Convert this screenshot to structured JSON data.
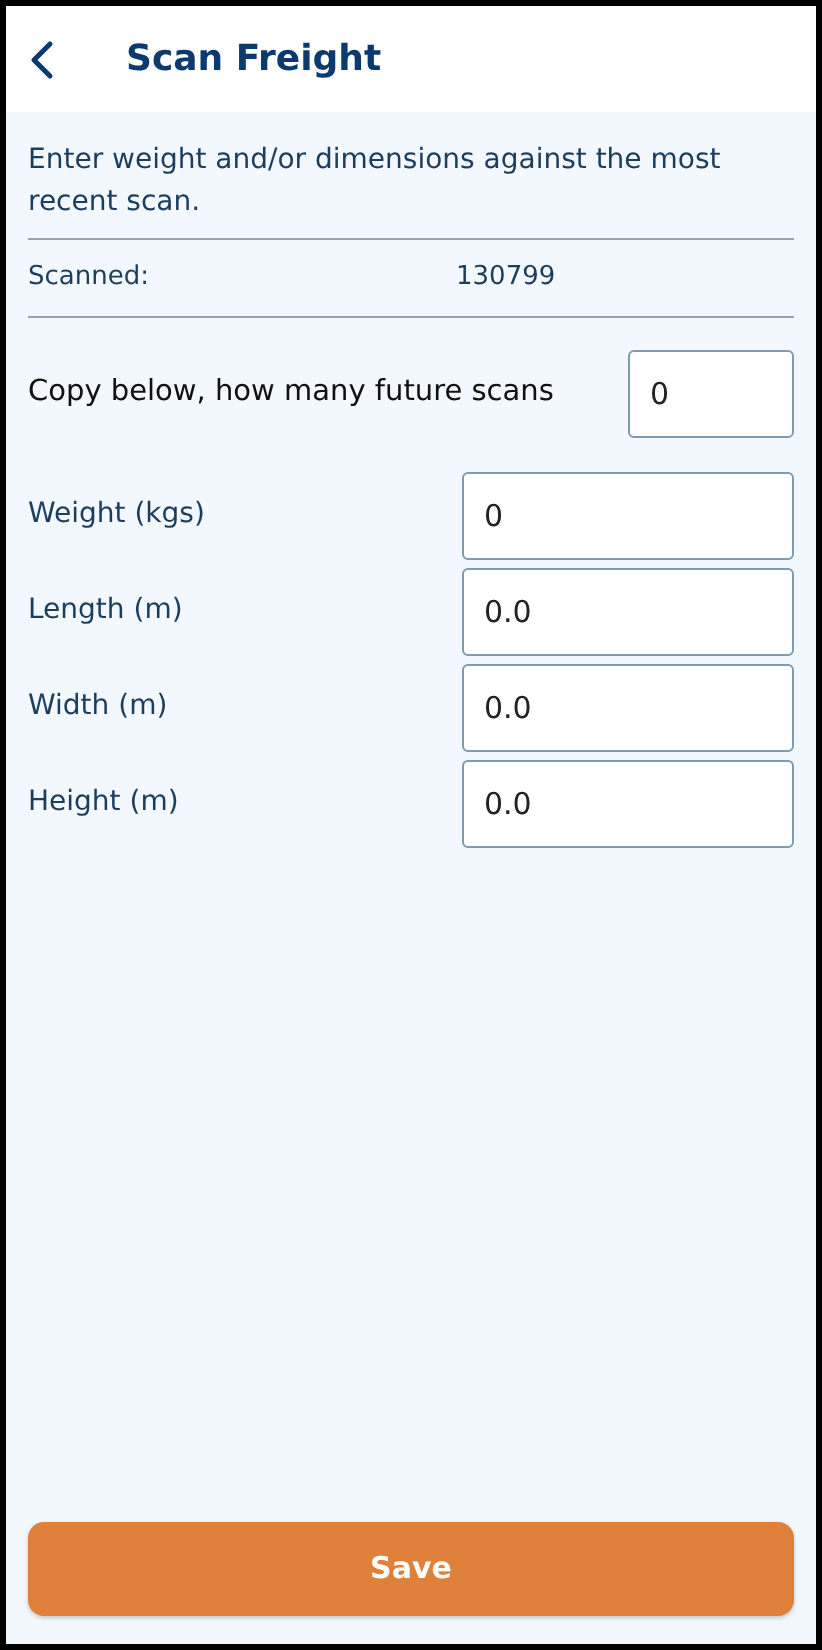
{
  "header": {
    "title": "Scan Freight"
  },
  "intro": "Enter weight and/or dimensions against the most recent scan.",
  "scanned": {
    "label": "Scanned:",
    "value": "130799"
  },
  "copy": {
    "label": "Copy below, how many future scans",
    "value": "0"
  },
  "fields": [
    {
      "label": "Weight (kgs)",
      "value": "0"
    },
    {
      "label": "Length (m)",
      "value": "0.0"
    },
    {
      "label": "Width (m)",
      "value": "0.0"
    },
    {
      "label": "Height (m)",
      "value": "0.0"
    }
  ],
  "save_button": "Save"
}
